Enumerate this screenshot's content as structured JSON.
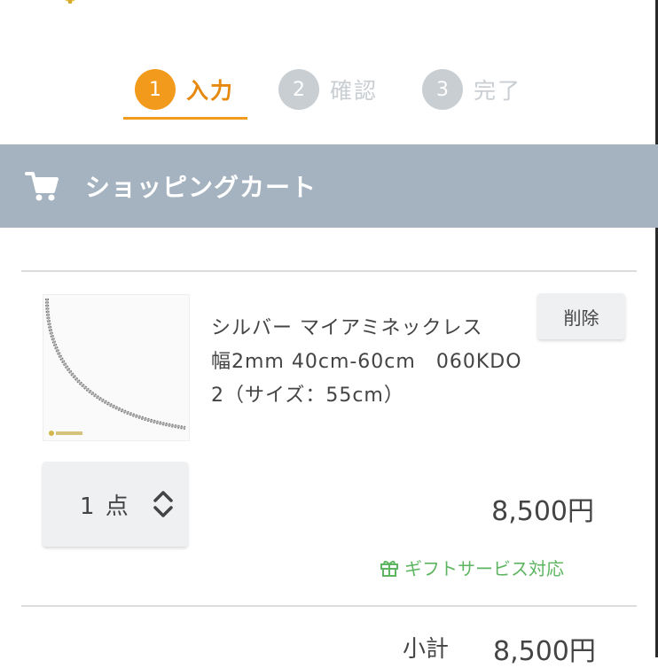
{
  "steps": [
    {
      "number": "1",
      "label": "入力",
      "state": "active"
    },
    {
      "number": "2",
      "label": "確認",
      "state": "inactive"
    },
    {
      "number": "3",
      "label": "完了",
      "state": "inactive"
    }
  ],
  "colors": {
    "accent": "#f29a1b",
    "header_bg": "#a4b3bf",
    "gift_green": "#5db561",
    "inactive_step": "#c9ced3"
  },
  "cart": {
    "title": "ショッピングカート",
    "icon": "shopping-cart-icon"
  },
  "item": {
    "name_lines": [
      "シルバー マイアミネックレス",
      "幅2mm 40cm-60cm　060KDO",
      "2（サイズ：55cm）"
    ],
    "delete_label": "削除",
    "quantity": "1 点",
    "price": "8,500円",
    "gift_label": "ギフトサービス対応",
    "gift_icon": "gift-icon"
  },
  "summary": {
    "subtotal_label": "小計",
    "subtotal_value": "8,500円"
  }
}
